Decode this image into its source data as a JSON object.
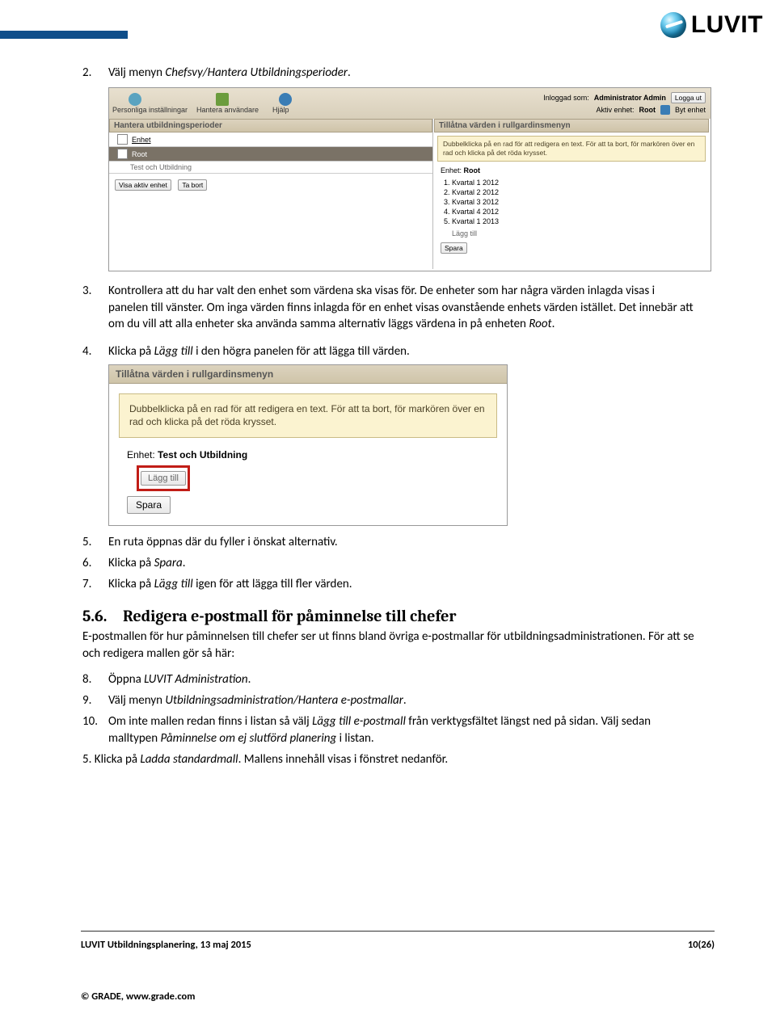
{
  "header": {
    "logo_text": "LUVIT"
  },
  "body": {
    "step2_pre": "Välj menyn ",
    "step2_menu": "Chefsvy/Hantera Utbildningsperioder",
    "step2_post": ".",
    "step3_pre": "Kontrollera att du har valt den enhet som värdena ska visas för. De enheter som har några värden inlagda visas i panelen till vänster. Om inga värden finns inlagda för en enhet visas ovanstående enhets värden istället. Det innebär att om du vill att alla enheter ska använda samma alternativ läggs värdena in på enheten ",
    "step3_root": "Root",
    "step3_post": ".",
    "step4_pre": "Klicka på ",
    "step4_link": "Lägg till",
    "step4_post": " i den högra panelen för att lägga till värden.",
    "step5": "En ruta öppnas där du fyller i önskat alternativ.",
    "step6_pre": "Klicka på ",
    "step6_btn": "Spara",
    "step6_post": ".",
    "step7_pre": "Klicka på ",
    "step7_link": "Lägg till",
    "step7_post": " igen för att lägga till fler värden.",
    "sec56_num": "5.6.",
    "sec56_title": "Redigera e-postmall för påminnelse till chefer",
    "sec56_intro": "E-postmallen för hur påminnelsen till chefer ser ut finns bland övriga e-postmallar för utbildningsadministrationen. För att se och redigera mallen gör så här:",
    "step8_pre": "Öppna ",
    "step8_app": "LUVIT Administration",
    "step8_post": ".",
    "step9_pre": "Välj menyn ",
    "step9_menu": "Utbildningsadministration/Hantera e-postmallar",
    "step9_post": ".",
    "step10_pre": "Om inte mallen redan finns i listan så välj ",
    "step10_link": "Lägg till e-postmall",
    "step10_mid": " från verktygsfältet längst ned på sidan. Välj sedan malltypen ",
    "step10_type": "Påminnelse om ej slutförd planering",
    "step10_post": " i listan.",
    "step5b_pre": "5. Klicka på ",
    "step5b_btn": "Ladda standardmall",
    "step5b_post": ". Mallens innehåll visas i fönstret nedanför."
  },
  "shot1": {
    "nav": {
      "pers": "Personliga inställningar",
      "users": "Hantera användare",
      "help": "Hjälp"
    },
    "topright": {
      "logged_in_as": "Inloggad som:",
      "admin": "Administrator Admin",
      "logout": "Logga ut",
      "active_unit": "Aktiv enhet:",
      "root": "Root",
      "switch": "Byt enhet"
    },
    "panelL": {
      "title": "Hantera utbildningsperioder",
      "row1": "Enhet",
      "row2": "Root",
      "row3": "Test och Utbildning",
      "btn_show": "Visa aktiv enhet",
      "btn_del": "Ta bort"
    },
    "panelR": {
      "title": "Tillåtna värden i rullgardinsmenyn",
      "tip": "Dubbelklicka på en rad för att redigera en text. För att ta bort, för markören över en rad och klicka på det röda krysset.",
      "unit_label": "Enhet:",
      "unit_value": "Root",
      "items": [
        "Kvartal 1 2012",
        "Kvartal 2 2012",
        "Kvartal 3 2012",
        "Kvartal 4 2012",
        "Kvartal 1 2013"
      ],
      "add": "Lägg till",
      "save": "Spara"
    }
  },
  "shot2": {
    "title": "Tillåtna värden i rullgardinsmenyn",
    "tip": "Dubbelklicka på en rad för att redigera en text. För att ta bort, för markören över en rad och klicka på det röda krysset.",
    "unit_label": "Enhet:",
    "unit_value": "Test och Utbildning",
    "add": "Lägg till",
    "save": "Spara"
  },
  "footer": {
    "doc": "LUVIT Utbildningsplanering, 13 maj 2015",
    "page": "10(26)",
    "copyright": "© GRADE, www.grade.com"
  }
}
